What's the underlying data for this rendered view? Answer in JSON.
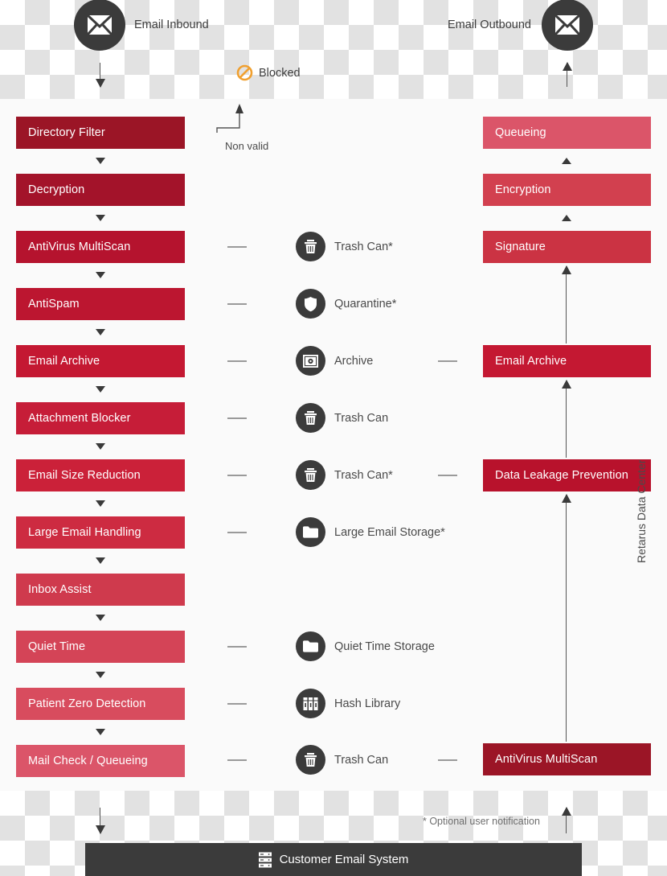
{
  "endpoints": {
    "inbound": {
      "label": "Email Inbound",
      "icon": "envelope-icon"
    },
    "outbound": {
      "label": "Email Outbound",
      "icon": "envelope-icon"
    }
  },
  "blocked": {
    "label": "Blocked",
    "icon": "prohibition-icon",
    "color": "#F0A030"
  },
  "non_valid": {
    "label": "Non valid"
  },
  "inbound_steps": [
    {
      "label": "Directory Filter",
      "color": "#9B1526"
    },
    {
      "label": "Decryption",
      "color": "#A3132A"
    },
    {
      "label": "AntiVirus MultiScan",
      "color": "#B5132E"
    },
    {
      "label": "AntiSpam",
      "color": "#BC1630"
    },
    {
      "label": "Email Archive",
      "color": "#C41832"
    },
    {
      "label": "Attachment Blocker",
      "color": "#C61D38"
    },
    {
      "label": "Email Size Reduction",
      "color": "#CB2139"
    },
    {
      "label": "Large Email Handling",
      "color": "#CD2B41"
    },
    {
      "label": "Inbox Assist",
      "color": "#CF3A4D"
    },
    {
      "label": "Quiet Time",
      "color": "#D44457"
    },
    {
      "label": "Patient Zero Detection",
      "color": "#D84C5E"
    },
    {
      "label": "Mail Check / Queueing",
      "color": "#DB5569"
    }
  ],
  "outbound_steps": [
    {
      "label": "Queueing",
      "color": "#DB5569"
    },
    {
      "label": "Encryption",
      "color": "#D2404F"
    },
    {
      "label": "Signature",
      "color": "#CB3343"
    },
    {
      "label": "Email Archive",
      "color": "#C41832"
    },
    {
      "label": "Data Leakage Prevention",
      "color": "#B8122C"
    },
    {
      "label": "AntiVirus MultiScan",
      "color": "#9B1526"
    }
  ],
  "storage_nodes": [
    {
      "label": "Trash Can*",
      "icon": "trash-can-icon"
    },
    {
      "label": "Quarantine*",
      "icon": "shield-icon"
    },
    {
      "label": "Archive",
      "icon": "safe-icon"
    },
    {
      "label": "Trash Can",
      "icon": "trash-can-icon"
    },
    {
      "label": "Trash Can*",
      "icon": "trash-can-icon"
    },
    {
      "label": "Large Email Storage*",
      "icon": "folder-icon"
    },
    {
      "label": "Quiet Time Storage",
      "icon": "folder-icon"
    },
    {
      "label": "Hash Library",
      "icon": "binders-icon"
    },
    {
      "label": "Trash Can",
      "icon": "trash-can-icon"
    }
  ],
  "data_center": {
    "label": "Retarus Data Center"
  },
  "footnote": {
    "text": "* Optional user notification"
  },
  "customer_system": {
    "label": "Customer Email System",
    "icon": "server-rack-icon"
  }
}
